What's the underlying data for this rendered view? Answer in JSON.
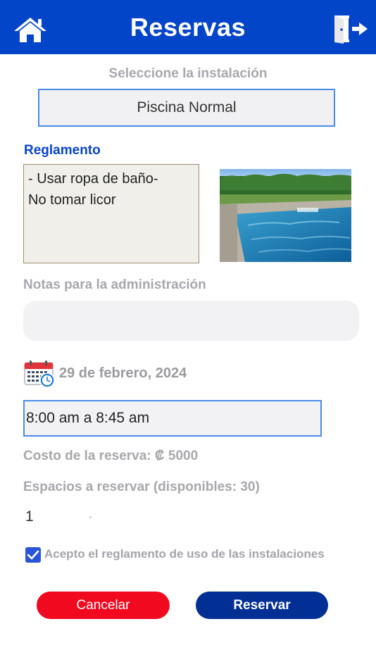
{
  "header": {
    "title": "Reservas"
  },
  "facility": {
    "label": "Seleccione la instalación",
    "selected": "Piscina Normal"
  },
  "rules": {
    "label": "Reglamento",
    "line1": "- Usar ropa de baño-",
    "line2": "No tomar licor"
  },
  "notes": {
    "label": "Notas para la administración",
    "value": ""
  },
  "date": {
    "text": "29 de febrero, 2024"
  },
  "time": {
    "selected": "8:00 am a 8:45 am"
  },
  "cost": {
    "text": "Costo de la reserva: ₡ 5000"
  },
  "spaces": {
    "label": "Espacios a reservar (disponibles: 30)",
    "value": "1"
  },
  "agreement": {
    "label": "Acepto el reglamento de uso de las instalaciones",
    "checked": true
  },
  "buttons": {
    "cancel": "Cancelar",
    "reserve": "Reservar"
  },
  "colors": {
    "header": "#0345c8",
    "cancel": "#f0091f",
    "reserve": "#022f93",
    "accent": "#0a44c9"
  }
}
